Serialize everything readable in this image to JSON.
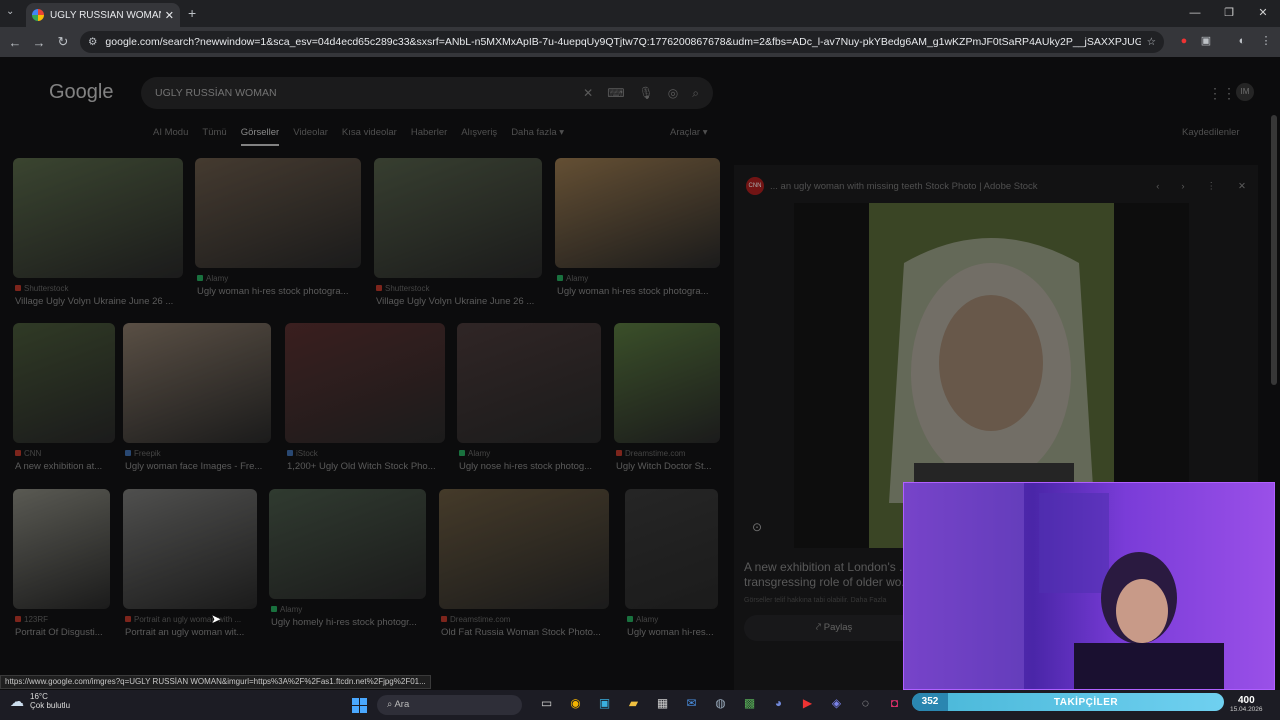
{
  "browser": {
    "tab_title": "UGLY RUSSİAN WOMAN - Goo",
    "url": "google.com/search?newwindow=1&sca_esv=04d4ecd65c289c33&sxsrf=ANbL-n5MXMxApIB-7u-4uepqUy9QTjtw7Q:1776200867678&udm=2&fbs=ADc_l-av7Nuy-pkYBedg6AM_g1wKZPmJF0tSaRP4AUky2P__jSAXXPJUGw0e79131bHRu5vWTbF2aoFlc..."
  },
  "google": {
    "logo": "Google",
    "query": "UGLY RUSSİAN WOMAN",
    "tabs": [
      "AI Modu",
      "Tümü",
      "Görseller",
      "Videolar",
      "Kısa videolar",
      "Haberler",
      "Alışveriş",
      "Daha fazla ▾"
    ],
    "active_tab": "Görseller",
    "tools": "Araçlar ▾",
    "saved": "Kaydedilenler"
  },
  "results": [
    {
      "src": "Shutterstock",
      "title": "Village Ugly Volyn Ukraine June 26 ...",
      "color": "#5a6a4a"
    },
    {
      "src": "Alamy",
      "title": "Ugly woman hi-res stock photogra...",
      "color": "#6a5a4a"
    },
    {
      "src": "Shutterstock",
      "title": "Village Ugly Volyn Ukraine June 26 ...",
      "color": "#55604a"
    },
    {
      "src": "Alamy",
      "title": "Ugly woman hi-res stock photogra...",
      "color": "#9a7a50"
    },
    {
      "src": "CNN",
      "title": "A new exhibition at...",
      "color": "#4a5a3a"
    },
    {
      "src": "Freepik",
      "title": "Ugly woman face Images - Fre...",
      "color": "#8a7a6a"
    },
    {
      "src": "iStock",
      "title": "1,200+ Ugly Old Witch Stock Pho...",
      "color": "#5a3030"
    },
    {
      "src": "Alamy",
      "title": "Ugly nose hi-res stock photog...",
      "color": "#4a3a3a"
    },
    {
      "src": "Dreamstime.com",
      "title": "Ugly Witch Doctor St...",
      "color": "#5a7a40"
    },
    {
      "src": "123RF",
      "title": "Portrait Of Disgusti...",
      "color": "#8a8a80"
    },
    {
      "src": "Portrait an ugly woman with ...",
      "title": "Portrait an ugly woman wit...",
      "color": "#7a7a78"
    },
    {
      "src": "Alamy",
      "title": "Ugly homely hi-res stock photogr...",
      "color": "#4a5a4a"
    },
    {
      "src": "Dreamstime.com",
      "title": "Old Fat Russia Woman Stock Photo...",
      "color": "#6a5a40"
    },
    {
      "src": "Alamy",
      "title": "Ugly woman hi-res...",
      "color": "#3a3a3a"
    }
  ],
  "panel": {
    "source": "CNN",
    "header_title": "... an ugly woman with missing teeth Stock Photo | Adobe Stock",
    "caption_line1": "A new exhibition at London's ...",
    "caption_line2": "transgressing role of older wo...",
    "subtext": "Görseller telif hakkına tabi olabilir. Daha Fazla",
    "share": "Paylaş"
  },
  "status_url": "https://www.google.com/imgres?q=UGLY RUSSİAN WOMAN&imgurl=https%3A%2F%2Fas1.ftcdn.net%2Fjpg%2F01...",
  "taskbar": {
    "temp": "16°C",
    "weather": "Çok bulutlu",
    "search_placeholder": "Ara",
    "date": "15.04.2026"
  },
  "overlay": {
    "followers_count": "352",
    "followers_label": "TAKİPÇİLER",
    "followers_goal": "400"
  }
}
